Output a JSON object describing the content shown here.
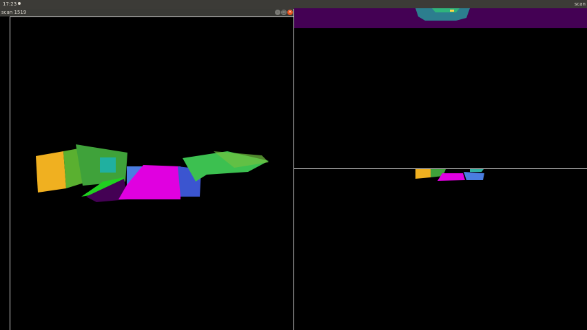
{
  "topbar": {
    "time": "17:23",
    "tray_icons": [
      "face-icon",
      "bag-icon",
      "keyboard-icon",
      "orange-dot-icon",
      "network-icon",
      "volume-icon",
      "power-icon",
      "chevron-down-icon"
    ]
  },
  "windows": {
    "left": {
      "title": "scan 1519"
    },
    "right": {
      "title": "scan"
    }
  },
  "colors": {
    "panel": "#3c3b37",
    "purple": "#440154",
    "magenta": "#e000e0",
    "yellow": "#f0b020",
    "green": "#40b040",
    "blue": "#3070e0",
    "close": "#e9541f"
  }
}
